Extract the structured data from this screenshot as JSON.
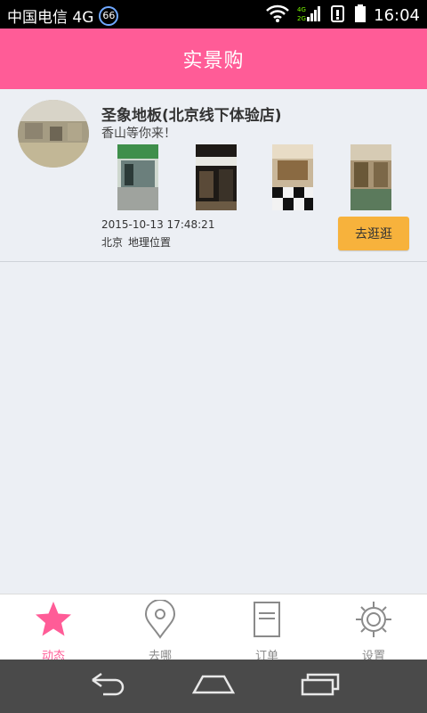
{
  "status_bar": {
    "carrier": "中国电信 4G",
    "badge": "66",
    "net_type": "4G",
    "time": "16:04"
  },
  "header": {
    "title": "实景购"
  },
  "store": {
    "name": "圣象地板(北京线下体验店)",
    "slogan": "香山等你来！",
    "datetime": "2015-10-13 17:48:21",
    "city": "北京",
    "location_label": "地理位置",
    "button_label": "去逛逛"
  },
  "tabs": [
    {
      "label": "动态",
      "icon": "star-icon",
      "active": true
    },
    {
      "label": "去哪",
      "icon": "location-pin-icon",
      "active": false
    },
    {
      "label": "订单",
      "icon": "order-document-icon",
      "active": false
    },
    {
      "label": "设置",
      "icon": "settings-gear-icon",
      "active": false
    }
  ],
  "colors": {
    "accent": "#ff5c97",
    "button": "#f7b23c",
    "tab_inactive": "#8a8a8a"
  }
}
